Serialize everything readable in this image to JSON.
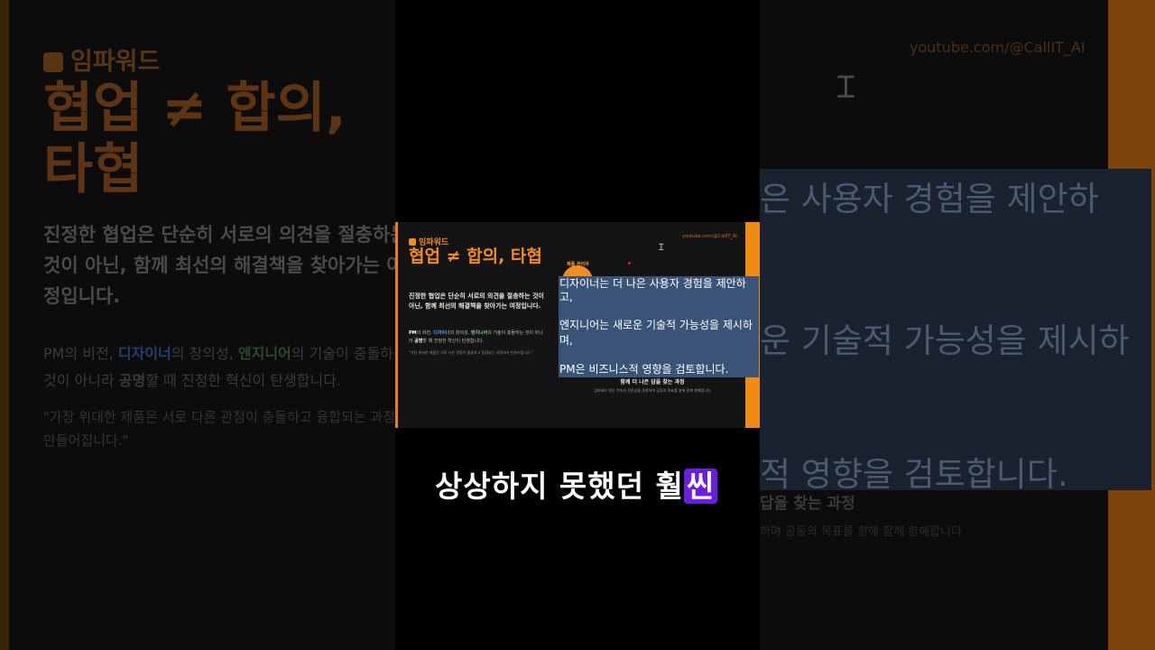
{
  "slide": {
    "brand": "임파워드",
    "url": "youtube.com/@CallIT_AI",
    "title": "협업 ≠ 합의, 타협",
    "intro": "진정한 협업은 단순히 서로의 의견을 절충하는 것이 아닌, 함께 최선의 해결책을 찾아가는 여정입니다.",
    "detail": {
      "p1": "PM",
      "p2": "의 비전, ",
      "p3": "디자이너",
      "p4": "의 창의성, ",
      "p5": "엔지니어",
      "p6": "의 기술이 충돌하는 것이 아니라 ",
      "p7": "공명",
      "p8": "할 때 진정한 혁신이 탄생합니다."
    },
    "quote": "\"가장 위대한 제품은 서로 다른 관점이 충돌하고 융합되는 과정에서 만들어집니다.\"",
    "circle_label": "제품 관리자",
    "selected_lines": [
      "디자이너는 더 나은 사용자 경험을 제안하",
      "고,",
      "엔지니어는 새로운 기술적 가능성을 제시하",
      "며,",
      "PM은 비즈니스적 영향을 검토합니다."
    ],
    "subtitle": "함께 더 나은 답을 찾는 과정",
    "subtext": "임파워드 팀은 각자의 전문성을 존중하며 공동의 목표를 향해 함께 항해합니다"
  },
  "background": {
    "visible_intro": [
      "진정한 협업은 단순히 서로의 의견을 절충하는",
      "것이 아닌, 함께 최선의 해결책을 찾아가는 여",
      "정입니다."
    ],
    "visible_detail_line2_a": "것이 아니라 ",
    "visible_detail_line2_b": "공명",
    "visible_detail_line2_c": "할 때 진정한 혁신이 탄생합니다.",
    "visible_quote": [
      "\"가장 위대한 제품은 서로 다른 관점이 충돌하고 융합되는 과정에서",
      "만들어집니다.\""
    ],
    "visible_sel_1": "은 사용자 경험을 제안하",
    "visible_sel_2": "운 기술적 가능성을 제시하",
    "visible_sel_3": "적 영향을 검토합니다.",
    "visible_sub1": "답을 찾는 과정",
    "visible_sub2": "하며 공동의 목표를 향해 함께 항해합니다"
  },
  "caption": {
    "text": "상상하지 못했던 훨",
    "highlight": "씬"
  },
  "colors": {
    "accent": "#F08D1C",
    "selection": "#3A5478",
    "caption_highlight": "#6A1EE0"
  }
}
